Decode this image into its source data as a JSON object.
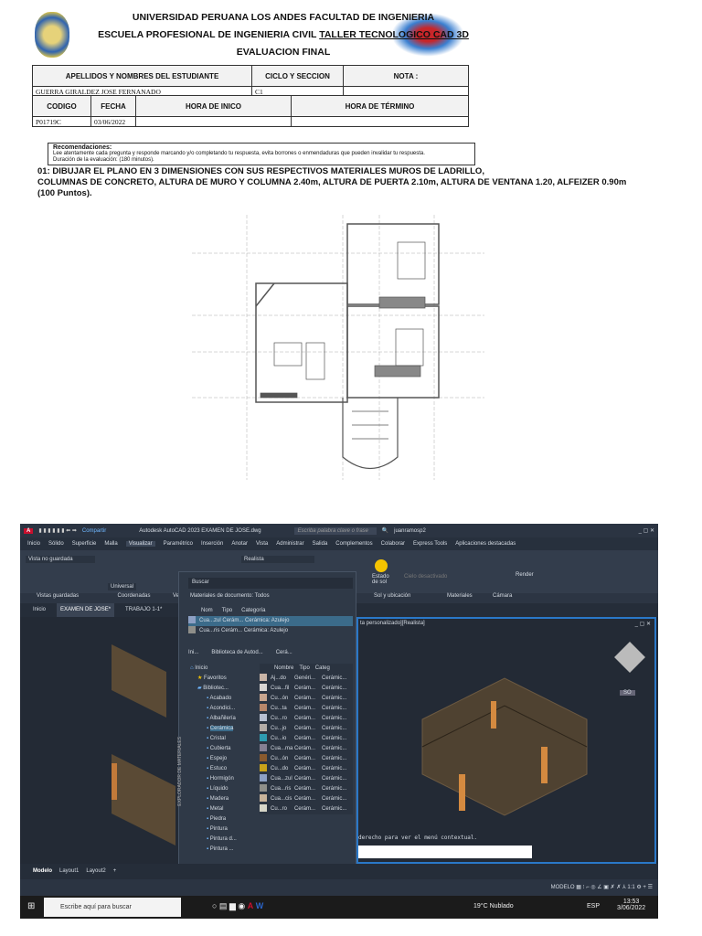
{
  "header": {
    "line1": "UNIVERSIDAD PERUANA LOS ANDES FACULTAD DE INGENIERIA",
    "line2_a": "ESCUELA PROFESIONAL DE INGENIERIA CIVIL ",
    "line2_b": "TALLER TECNOLOGICO CAD 3D",
    "line3": "EVALUACION FINAL"
  },
  "student_table": {
    "headers": [
      "APELLIDOS Y NOMBRES DEL ESTUDIANTE",
      "CICLO Y SECCION",
      "NOTA :"
    ],
    "values": [
      "GUERRA GIRALDEZ JOSE FERNANADO",
      "C1",
      ""
    ]
  },
  "time_table": {
    "headers": [
      "CODIGO",
      "FECHA",
      "HORA DE INICO",
      "HORA DE TÉRMINO"
    ],
    "values": [
      "P01719C",
      "03/06/2022",
      "",
      ""
    ]
  },
  "recommendations": {
    "title": "Recomendaciones:",
    "line1": "Lee atentamente cada pregunta y responde marcando y/o completando tu respuesta, evita borrones o enmendaduras que pueden invalidar tu respuesta.",
    "line2": "Duración de la evaluación: (180 minutos)."
  },
  "question": {
    "line1": "01: DIBUJAR EL PLANO EN 3 DIMENSIONES CON SUS RESPECTIVOS MATERIALES MUROS DE LADRILLO,",
    "line2": "COLUMNAS DE CONCRETO, ALTURA DE MURO Y COLUMNA 2.40m, ALTURA DE PUERTA 2.10m, ALTURA DE VENTANA 1.20, ALFEIZER 0.90m",
    "line3": "(100 Puntos)."
  },
  "autocad": {
    "title": "Autodesk AutoCAD 2023   EXAMEN DE JOSE.dwg",
    "share": "Compartir",
    "search_placeholder": "Escriba palabra clave o frase",
    "user": "juanramosp2",
    "menu": [
      "Inicio",
      "Sólido",
      "Superficie",
      "Malla",
      "Visualizar",
      "Paramétrico",
      "Inserción",
      "Anotar",
      "Vista",
      "Administrar",
      "Salida",
      "Complementos",
      "Colaborar",
      "Express Tools",
      "Aplicaciones destacadas"
    ],
    "ribbon": {
      "saved_view": "Vista no guardada",
      "ucs": "Universal",
      "visual_style": "Realista",
      "panels": [
        "Vistas guardadas",
        "Coordenadas",
        "Ve",
        "Sol y ubicación",
        "Materiales",
        "Cámara"
      ],
      "sun_state": "Estado de sol",
      "sky": "Cielo desactivado",
      "render": "Render"
    },
    "doc_tabs": [
      "Inicio",
      "EXAMEN DE JOSE*",
      "TRABAJO 1-1*"
    ],
    "viewport_label": "ta personalizado][Realista]",
    "cube_label": "SO",
    "command_hint": "derecho para ver el menú contextual.",
    "layout_tabs": [
      "Modelo",
      "Layout1",
      "Layout2",
      "+"
    ],
    "status_model": "MODELO",
    "status_scale": "1:1",
    "palette": {
      "side_title": "EXPLORADOR DE MATERIALES",
      "search": "Buscar",
      "doc_materials": "Materiales de documento: Todos",
      "doc_cols": [
        "Nom",
        "Tipo",
        "Categoría"
      ],
      "doc_rows": [
        [
          "Cua...zul",
          "Cerám...",
          "Cerámica: Azulejo"
        ],
        [
          "Cua...ris",
          "Cerám...",
          "Cerámica: Azulejo"
        ]
      ],
      "lib_bar": [
        "Ini...",
        "Biblioteca de Autod...",
        "Cerá..."
      ],
      "tree": [
        "Inicio",
        "Favoritos",
        "Bibliotec...",
        "Acabado",
        "Acondici...",
        "Albañilería",
        "Cerámica",
        "Cristal",
        "Cubierta",
        "Espejo",
        "Estuco",
        "Hormigón",
        "Líquido",
        "Madera",
        "Metal",
        "Piedra",
        "Pintura",
        "Pintura d...",
        "Pintura ..."
      ],
      "lib_cols": [
        "Nombre",
        "Tipo",
        "Categ"
      ],
      "lib_rows": [
        [
          "Aj...do",
          "Genéri...",
          "Cerámic...",
          "#c9b4a6"
        ],
        [
          "Cua...fil",
          "Cerám...",
          "Cerámic...",
          "#d8d4d2"
        ],
        [
          "Cu...ón",
          "Cerám...",
          "Cerámic...",
          "#c8a58e"
        ],
        [
          "Cu...ta",
          "Cerám...",
          "Cerámic...",
          "#b8876a"
        ],
        [
          "Cu...ro",
          "Cerám...",
          "Cerámic...",
          "#b8bfd0"
        ],
        [
          "Cu...jo",
          "Cerám...",
          "Cerámic...",
          "#b4aca6"
        ],
        [
          "Cu...io",
          "Cerám...",
          "Cerámic...",
          "#2e9bb0"
        ],
        [
          "Cua...ma",
          "Cerám...",
          "Cerámic...",
          "#857f92"
        ],
        [
          "Cu...ón",
          "Cerám...",
          "Cerámic...",
          "#8a5a2e"
        ],
        [
          "Cu...do",
          "Cerám...",
          "Cerámic...",
          "#c9a21a"
        ],
        [
          "Cua...zul",
          "Cerám...",
          "Cerámic...",
          "#8da0c4"
        ],
        [
          "Cua...ris",
          "Cerám...",
          "Cerámic...",
          "#8f8f8a"
        ],
        [
          "Cua...cis",
          "Cerám...",
          "Cerámic...",
          "#c8b39a"
        ],
        [
          "Cu...ro",
          "Cerám...",
          "Cerámic...",
          "#d7d6c8"
        ]
      ]
    },
    "taskbar": {
      "search": "Escribe aquí para buscar",
      "weather": "19°C  Nublado",
      "lang": "ESP",
      "time": "13:53",
      "date": "3/06/2022"
    }
  }
}
